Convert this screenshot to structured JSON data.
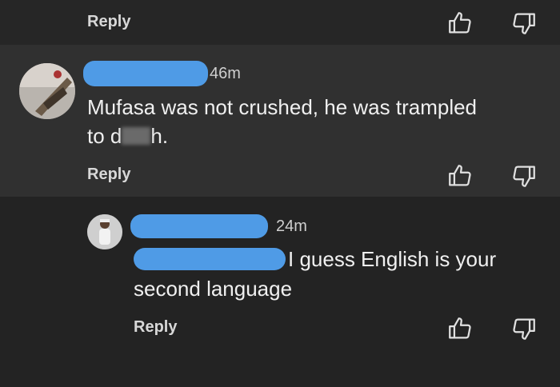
{
  "top": {
    "reply_label": "Reply"
  },
  "comment1": {
    "time": "46m",
    "text_prefix": "Mufasa was not crushed, he was trampled",
    "text_line2_start": "to d",
    "text_line2_end": "h.",
    "reply_label": "Reply"
  },
  "comment2": {
    "time": "24m",
    "text_line1": "I guess English is your",
    "text_line2": "second language",
    "reply_label": "Reply"
  },
  "colors": {
    "redaction": "#4f9be6",
    "background": "#232323",
    "highlight": "#303030"
  },
  "icons": [
    "thumbs-up-icon",
    "thumbs-down-icon"
  ]
}
